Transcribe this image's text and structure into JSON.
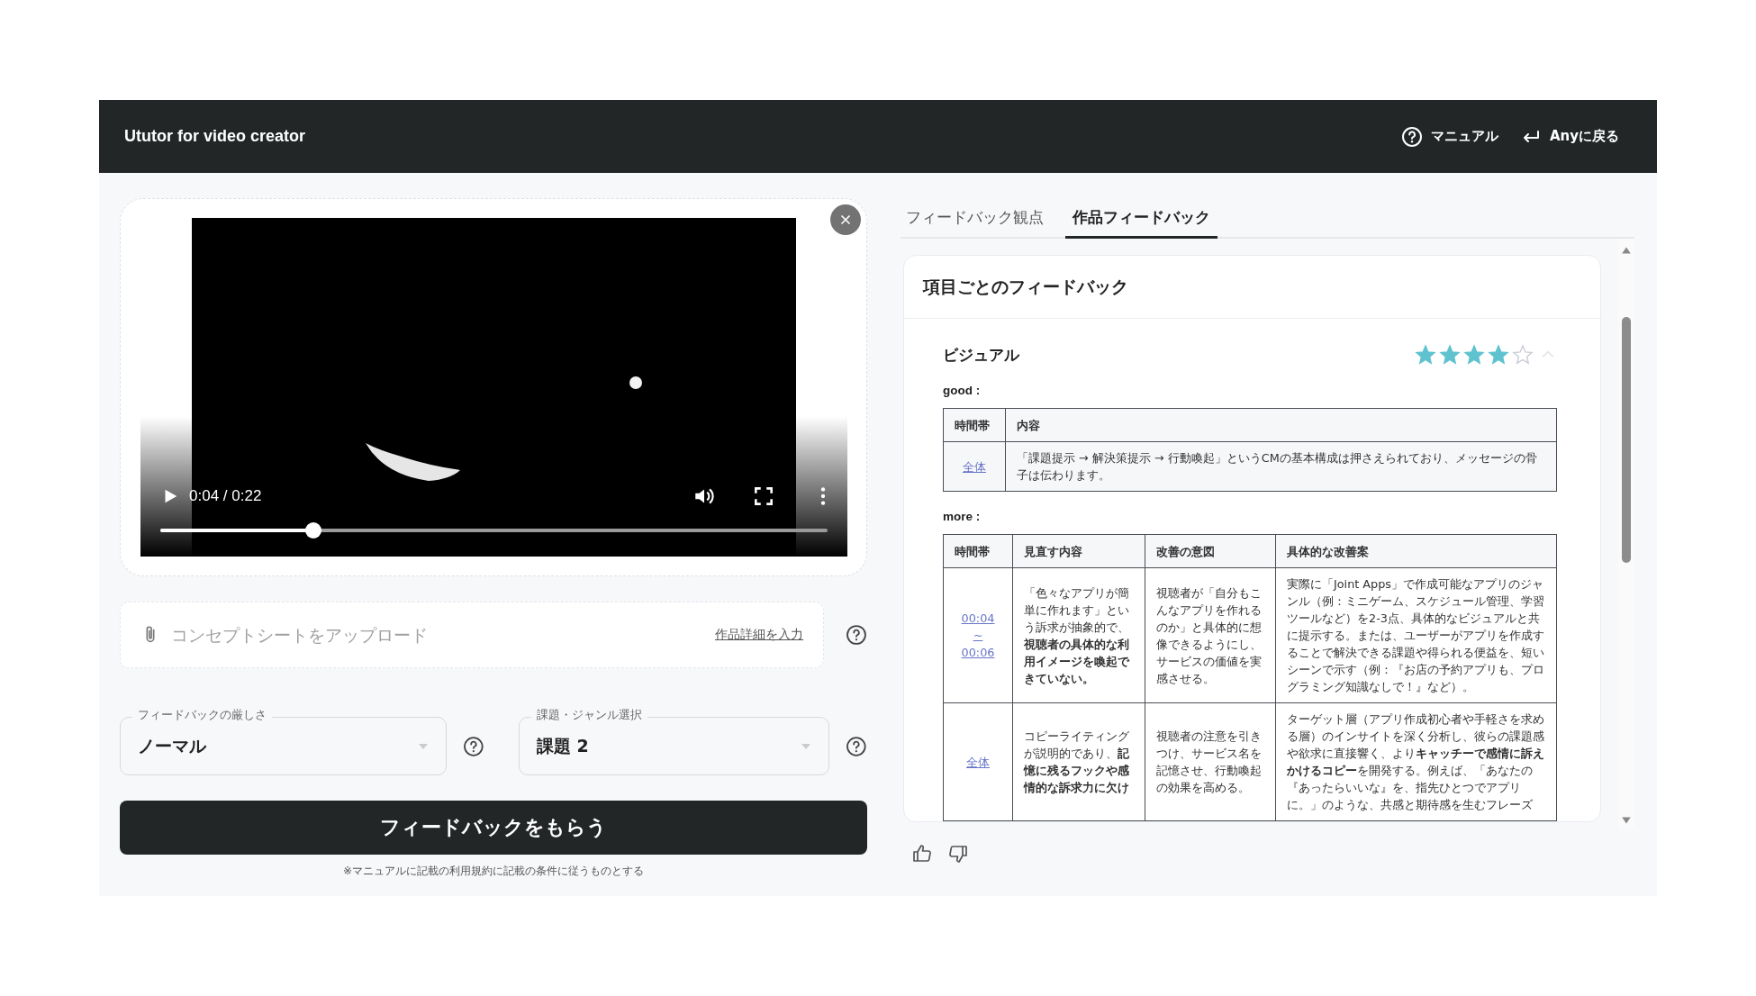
{
  "header": {
    "title": "Ututor for video creator",
    "links": [
      {
        "kind": "help",
        "label": "マニュアル"
      },
      {
        "kind": "back",
        "label": "Anyに戻る"
      }
    ]
  },
  "video": {
    "time": "0:04 / 0:22",
    "level": 0.23
  },
  "upload": {
    "placeholder": "コンセプトシートをアップロード",
    "link": "作品詳細を入力"
  },
  "selects": [
    {
      "label": "フィードバックの厳しさ",
      "value": "ノーマル"
    },
    {
      "label": "課題・ジャンル選択",
      "value": "課題 2"
    }
  ],
  "submit": "フィードバックをもらう",
  "note": "※マニュアルに記載の利用規約に記載の条件に従うものとする",
  "tabs": [
    {
      "label": "フィードバック観点",
      "selected": false
    },
    {
      "label": "作品フィードバック",
      "selected": true
    }
  ],
  "feedback": {
    "title": "項目ごとのフィードバック",
    "sections": [
      {
        "name": "ビジュアル",
        "stars": 4,
        "expanded": true,
        "tables": [
          {
            "label": "good :",
            "columns": [
              "時間帯",
              "内容"
            ],
            "rows": [
              [
                "全体",
                "「課題提示 → 解決策提示 → 行動喚起」というCMの基本構成は押さえられており、メッセージの骨子は伝わります。"
              ]
            ]
          },
          {
            "label": "more :",
            "columns": [
              "時間帯",
              "見直す内容",
              "改善の意図",
              "具体的な改善案"
            ],
            "rows": [
              [
                "00:04 ~ 00:06",
                "「色々なアプリが簡単に作れます」という訴求が抽象的で、**視聴者の具体的な利用イメージを喚起できていない。**",
                "視聴者が「自分もこんなアプリを作れるのか」と具体的に想像できるようにし、サービスの価値を実感させる。",
                "実際に「Joint Apps」で作成可能なアプリのジャンル（例：ミニゲーム、スケジュール管理、学習ツールなど）を2-3点、具体的なビジュアルと共に提示する。または、ユーザーがアプリを作成することで解決できる課題や得られる便益を、短いシーンで示す（例：『お店の予約アプリも、プログラミング知識なしで！』など）。"
              ],
              [
                "全体",
                "コピーライティングが説明的であり、**記憶に残るフックや感情的な訴求力に欠け**",
                "視聴者の注意を引きつけ、サービス名を記憶させ、行動喚起の効果を高める。",
                "ターゲット層（アプリ作成初心者や手軽さを求める層）のインサイトを深く分析し、彼らの課題感や欲求に直接響く、より**キャッチーで感情に訴えかけるコピー**を開発する。例えば、「あなたの『あったらいいな』を、指先ひとつでアプリに。」のような、共感と期待感を生むフレーズ"
              ]
            ]
          }
        ]
      }
    ]
  }
}
